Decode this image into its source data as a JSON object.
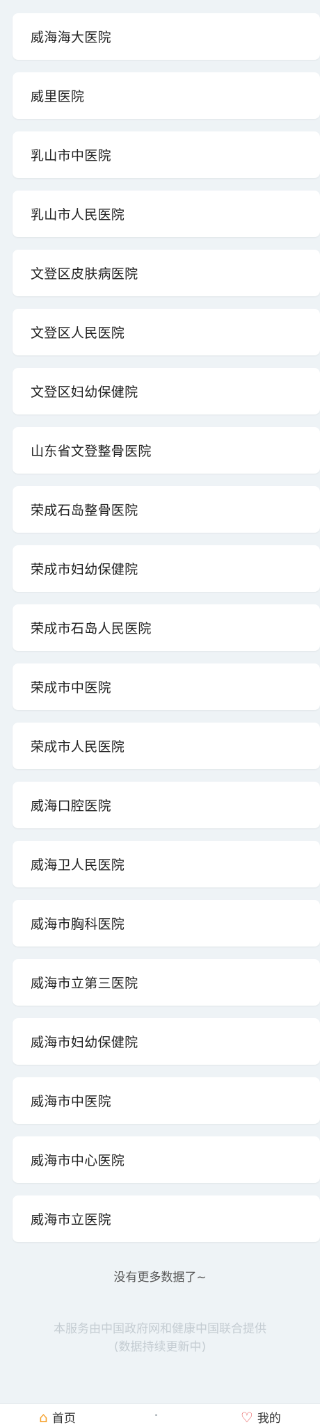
{
  "hospitals": [
    "威海海大医院",
    "威里医院",
    "乳山市中医院",
    "乳山市人民医院",
    "文登区皮肤病医院",
    "文登区人民医院",
    "文登区妇幼保健院",
    "山东省文登整骨医院",
    "荣成石岛整骨医院",
    "荣成市妇幼保健院",
    "荣成市石岛人民医院",
    "荣成市中医院",
    "荣成市人民医院",
    "威海口腔医院",
    "威海卫人民医院",
    "威海市胸科医院",
    "威海市立第三医院",
    "威海市妇幼保健院",
    "威海市中医院",
    "威海市中心医院",
    "威海市立医院"
  ],
  "no_more_text": "没有更多数据了~",
  "footer": {
    "line1": "本服务由中国政府网和健康中国联合提供",
    "line2": "(数据持续更新中)"
  },
  "tabbar": {
    "items": [
      {
        "label": "首页",
        "icon": "home-icon"
      },
      {
        "label": "",
        "icon": "center-icon"
      },
      {
        "label": "我的",
        "icon": "heart-icon"
      }
    ]
  },
  "colors": {
    "background": "#eef3f6",
    "card": "#ffffff",
    "text": "#222222",
    "footer_text": "#c4ccd2"
  }
}
